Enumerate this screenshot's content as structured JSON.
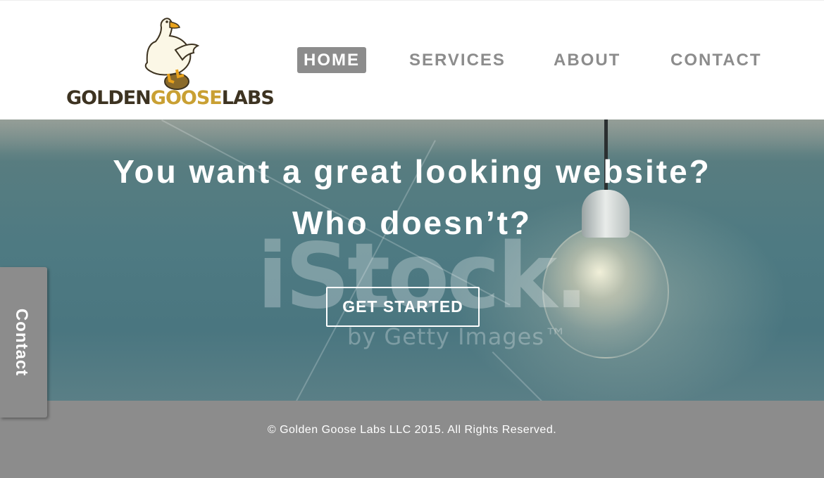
{
  "brand": {
    "logo_word1": "GOLDEN",
    "logo_word2": "GOOSE",
    "logo_word3": "LABS",
    "logo_icon": "goose-icon",
    "colors": {
      "dark": "#3d3321",
      "gold": "#c9a033"
    }
  },
  "nav": {
    "items": [
      {
        "label": "HOME",
        "active": true
      },
      {
        "label": "SERVICES",
        "active": false
      },
      {
        "label": "ABOUT",
        "active": false
      },
      {
        "label": "CONTACT",
        "active": false
      }
    ],
    "colors": {
      "inactive": "#8c8c8c",
      "active_bg": "#8c8c8c",
      "active_text": "#ffffff"
    }
  },
  "hero": {
    "line1": "You want a great looking website?",
    "line2": "Who doesn’t?",
    "cta_label": "GET STARTED",
    "watermark": "iStock.",
    "watermark_sub": "by Getty Images™"
  },
  "side_tab": {
    "label": "Contact"
  },
  "footer": {
    "copyright": "© Golden Goose Labs LLC 2015. All Rights Reserved.",
    "bg_color": "#8c8c8c"
  }
}
